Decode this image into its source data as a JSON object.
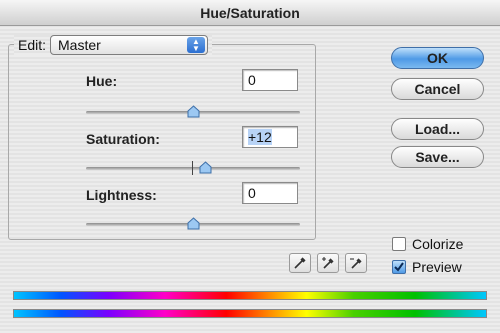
{
  "window": {
    "title": "Hue/Saturation"
  },
  "edit": {
    "label": "Edit:",
    "selected": "Master"
  },
  "hue": {
    "label": "Hue:",
    "value": "0",
    "slider_fraction": 0.5
  },
  "saturation": {
    "label": "Saturation:",
    "value": "+12",
    "slider_fraction": 0.56
  },
  "lightness": {
    "label": "Lightness:",
    "value": "0",
    "slider_fraction": 0.5
  },
  "buttons": {
    "ok": "OK",
    "cancel": "Cancel",
    "load": "Load...",
    "save": "Save..."
  },
  "options": {
    "colorize": {
      "label": "Colorize",
      "checked": false
    },
    "preview": {
      "label": "Preview",
      "checked": true
    }
  },
  "icons": [
    "chevron-updown-icon",
    "eyedropper-icon",
    "eyedropper-plus-icon",
    "eyedropper-minus-icon",
    "checkmark-icon"
  ],
  "colors": {
    "accent": "#4f9ae6",
    "thumb": "#9cc8f2"
  }
}
